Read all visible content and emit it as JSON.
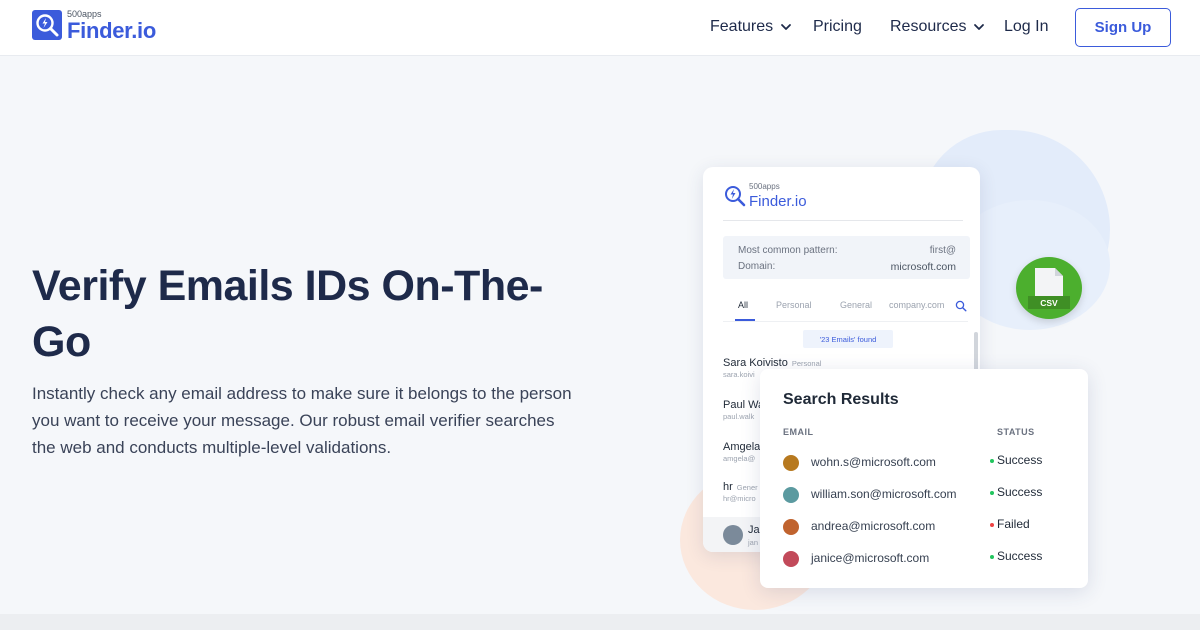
{
  "header": {
    "logo_small": "500apps",
    "logo_big": "Finder.io",
    "nav": {
      "features": "Features",
      "pricing": "Pricing",
      "resources": "Resources",
      "login": "Log In",
      "signup": "Sign Up"
    }
  },
  "hero": {
    "title_line1": "Verify Emails IDs On-The-",
    "title_line2": "Go",
    "description": "Instantly check any email address to make sure it belongs to the person you want to receive your message. Our robust email verifier searches the web and conducts multiple-level validations."
  },
  "finder_card": {
    "logo_small": "500apps",
    "logo_big": "Finder.io",
    "pattern_label": "Most common pattern:",
    "pattern_value": "first@",
    "domain_label": "Domain:",
    "domain_value": "microsoft.com",
    "tabs": [
      "All",
      "Personal",
      "General",
      "company.com"
    ],
    "found": "'23 Emails' found",
    "rows": [
      {
        "name": "Sara Koivisto",
        "tag": "Personal",
        "sub": "sara.koivi"
      },
      {
        "name": "Paul Wa",
        "tag": "",
        "sub": "paul.walk"
      },
      {
        "name": "Amgela",
        "tag": "",
        "sub": "amgela@"
      },
      {
        "name": "hr",
        "tag": "Gener",
        "sub": "hr@micro"
      }
    ],
    "bottom_name": "Ja",
    "bottom_sub": "jan"
  },
  "csv_badge": "CSV",
  "results": {
    "title": "Search Results",
    "col_email": "EMAIL",
    "col_status": "STATUS",
    "rows": [
      {
        "email": "wohn.s@microsoft.com",
        "status": "Success",
        "dot": "#22c55e",
        "avatar": "#b7791f"
      },
      {
        "email": "william.son@microsoft.com",
        "status": "Success",
        "dot": "#22c55e",
        "avatar": "#5b9aa0"
      },
      {
        "email": "andrea@microsoft.com",
        "status": "Failed",
        "dot": "#ef4444",
        "avatar": "#c0632e"
      },
      {
        "email": "janice@microsoft.com",
        "status": "Success",
        "dot": "#22c55e",
        "avatar": "#c24a5a"
      }
    ]
  },
  "colors": {
    "brand": "#3b5bdb",
    "heading": "#1e2a4a",
    "csv_green": "#4caf2e"
  }
}
